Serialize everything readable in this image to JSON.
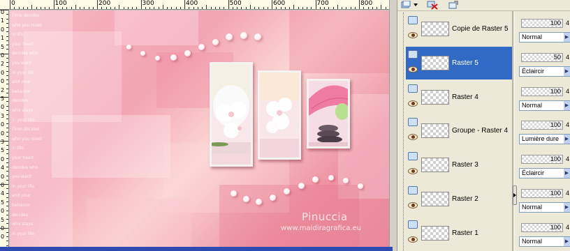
{
  "ruler": {
    "h_labels": [
      "0",
      "100",
      "200",
      "300",
      "400",
      "500",
      "600",
      "700",
      "800"
    ],
    "v_labels": [
      "0",
      "1",
      "0",
      "1",
      "5",
      "0",
      "2",
      "0",
      "0",
      "2",
      "5",
      "0",
      "3",
      "0",
      "0",
      "3",
      "5",
      "0",
      "4",
      "0",
      "0",
      "4",
      "5",
      "0",
      "5",
      "0",
      "0"
    ]
  },
  "canvas": {
    "watermark_name": "Pinuccia",
    "watermark_url": "www.maidiragrafica.eu",
    "poem_lines": [
      "Time decides",
      "who you meet",
      "in life,",
      "your heart",
      "decides who",
      "you want",
      "in your life",
      "and your",
      "behavior",
      "decides",
      "who stays",
      "in your life.",
      "Time decides",
      "who you meet",
      "in life,",
      "your heart",
      "decides who",
      "you want",
      "in your life",
      "and your",
      "behavior",
      "decides",
      "who stays",
      "in your life."
    ]
  },
  "layers": [
    {
      "name": "Copie de Raster 5",
      "opacity": "100",
      "extra": "4",
      "blend": "Normal",
      "selected": false
    },
    {
      "name": "Raster 5",
      "opacity": "50",
      "extra": "4",
      "blend": "Éclaircir",
      "selected": true
    },
    {
      "name": "Raster 4",
      "opacity": "100",
      "extra": "4",
      "blend": "Normal",
      "selected": false
    },
    {
      "name": "Groupe - Raster 4",
      "opacity": "100",
      "extra": "4",
      "blend": "Lumière dure",
      "selected": false
    },
    {
      "name": "Raster 3",
      "opacity": "100",
      "extra": "4",
      "blend": "Éclaircir",
      "selected": false
    },
    {
      "name": "Raster 2",
      "opacity": "100",
      "extra": "4",
      "blend": "Normal",
      "selected": false
    },
    {
      "name": "Raster 1",
      "opacity": "100",
      "extra": "4",
      "blend": "Normal",
      "selected": false
    }
  ],
  "colors": {
    "selection": "#316ac5",
    "panel": "#ece9d8"
  }
}
